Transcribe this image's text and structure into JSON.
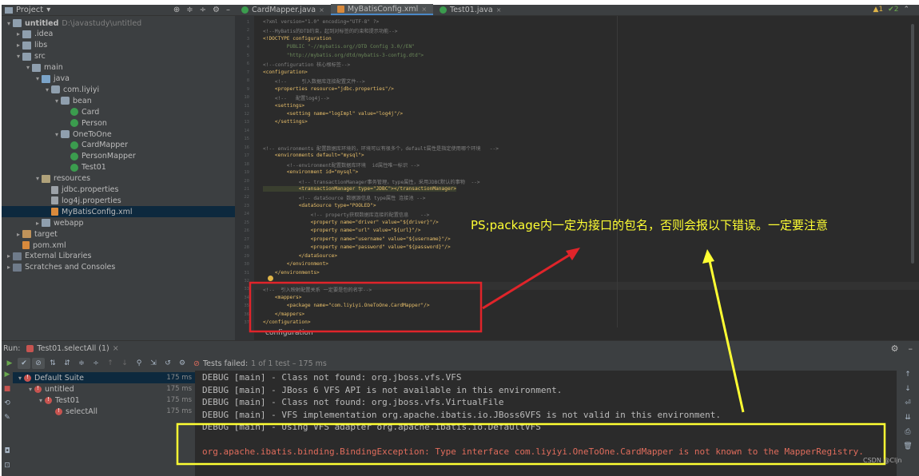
{
  "project": {
    "title": "Project",
    "tree": [
      {
        "label": "untitled",
        "path": "D:\\javastudy\\untitled",
        "arrow": "▾",
        "icon": "folder",
        "indent": 0,
        "bold": true
      },
      {
        "label": ".idea",
        "arrow": "▸",
        "icon": "folder",
        "indent": 1
      },
      {
        "label": "libs",
        "arrow": "▸",
        "icon": "folder",
        "indent": 1
      },
      {
        "label": "src",
        "arrow": "▾",
        "icon": "folder",
        "indent": 1
      },
      {
        "label": "main",
        "arrow": "▾",
        "icon": "folder",
        "indent": 2
      },
      {
        "label": "java",
        "arrow": "▾",
        "icon": "src",
        "indent": 3
      },
      {
        "label": "com.liyiyi",
        "arrow": "▾",
        "icon": "pkg",
        "indent": 4
      },
      {
        "label": "bean",
        "arrow": "▾",
        "icon": "pkg",
        "indent": 5
      },
      {
        "label": "Card",
        "arrow": "",
        "icon": "class",
        "indent": 6
      },
      {
        "label": "Person",
        "arrow": "",
        "icon": "class",
        "indent": 6
      },
      {
        "label": "OneToOne",
        "arrow": "▾",
        "icon": "pkg",
        "indent": 5
      },
      {
        "label": "CardMapper",
        "arrow": "",
        "icon": "class",
        "indent": 6
      },
      {
        "label": "PersonMapper",
        "arrow": "",
        "icon": "class",
        "indent": 6
      },
      {
        "label": "Test01",
        "arrow": "",
        "icon": "class",
        "indent": 6
      },
      {
        "label": "resources",
        "arrow": "▾",
        "icon": "res",
        "indent": 3
      },
      {
        "label": "jdbc.properties",
        "arrow": "",
        "icon": "file",
        "indent": 4
      },
      {
        "label": "log4j.properties",
        "arrow": "",
        "icon": "file",
        "indent": 4
      },
      {
        "label": "MyBatisConfig.xml",
        "arrow": "",
        "icon": "xml",
        "indent": 4,
        "selected": true
      },
      {
        "label": "webapp",
        "arrow": "▸",
        "icon": "folder",
        "indent": 3
      },
      {
        "label": "target",
        "arrow": "▸",
        "icon": "target",
        "indent": 1
      },
      {
        "label": "pom.xml",
        "arrow": "",
        "icon": "xml",
        "indent": 1
      },
      {
        "label": "External Libraries",
        "arrow": "▸",
        "icon": "lib",
        "indent": 0
      },
      {
        "label": "Scratches and Consoles",
        "arrow": "▸",
        "icon": "lib",
        "indent": 0
      }
    ]
  },
  "editor": {
    "tabs": [
      {
        "label": "CardMapper.java",
        "icon": "class",
        "active": false
      },
      {
        "label": "MyBatisConfig.xml",
        "icon": "xml",
        "active": true
      },
      {
        "label": "Test01.java",
        "icon": "class",
        "active": false
      }
    ],
    "inspections": {
      "warnings": "▲1",
      "ok": "✔2"
    },
    "breadcrumb": "configuration",
    "lines": [
      "<?xml version=\"1.0\" encoding=\"UTF-8\" ?>",
      "<!--MyBatis的DTD约束，起到对标签的约束和提示功能-->",
      "<!DOCTYPE configuration",
      "        PUBLIC \"-//mybatis.org//DTD Config 3.0//EN\"",
      "        \"http://mybatis.org/dtd/mybatis-3-config.dtd\">",
      "<!--configuration 核心根标签-->",
      "<configuration>",
      "    <!--     引入数据库连接配置文件-->",
      "    <properties resource=\"jdbc.properties\"/>",
      "    <!--   配置log4j-->",
      "    <settings>",
      "        <setting name=\"logImpl\" value=\"log4j\"/>",
      "    </settings>",
      "",
      "",
      "<!-- environments 配置数据库环境的，环境可以有很多个，default属性是指定使用哪个环境   -->",
      "    <environments default=\"mysql\">",
      "        <!--environment配置数据库环境  id属性唯一标识 -->",
      "        <environment id=\"mysql\">",
      "            <!-- transactionManager事务管理，type属性，采用JDBC默认的事物  -->",
      "            <transactionManager type=\"JDBC\"></transactionManager>",
      "            <!-- dataSource 数据源信息 type属性 连接池 -->",
      "            <dataSource type=\"POOLED\">",
      "                <!-- property获取数据库连接的配置信息    -->",
      "                <property name=\"driver\" value=\"${driver}\"/>",
      "                <property name=\"url\" value=\"${url}\"/>",
      "                <property name=\"username\" value=\"${username}\"/>",
      "                <property name=\"password\" value=\"${password}\"/>",
      "            </dataSource>",
      "        </environment>",
      "    </environments>",
      "",
      "<!--  引入映射配置关系 一定要是包的名字-->",
      "    <mappers>",
      "        <package name=\"com.liyiyi.OneToOne.CardMapper\"/>",
      "    </mappers>",
      "</configuration>"
    ]
  },
  "run": {
    "label": "Run:",
    "tab": "Test01.selectAll (1)",
    "status": {
      "failed": "Tests failed:",
      "detail": "1 of 1 test – 175 ms"
    },
    "tests": [
      {
        "label": "Default Suite",
        "time": "175 ms",
        "arrow": "▾",
        "indent": 0,
        "selected": true
      },
      {
        "label": "untitled",
        "time": "175 ms",
        "arrow": "▾",
        "indent": 1
      },
      {
        "label": "Test01",
        "time": "175 ms",
        "arrow": "▾",
        "indent": 2
      },
      {
        "label": "selectAll",
        "time": "175 ms",
        "arrow": "",
        "indent": 3
      }
    ],
    "console": [
      {
        "text": "DEBUG [main] - Class not found: org.jboss.vfs.VFS",
        "err": false
      },
      {
        "text": "DEBUG [main] - JBoss 6 VFS API is not available in this environment.",
        "err": false
      },
      {
        "text": "DEBUG [main] - Class not found: org.jboss.vfs.VirtualFile",
        "err": false
      },
      {
        "text": "DEBUG [main] - VFS implementation org.apache.ibatis.io.JBoss6VFS is not valid in this environment.",
        "err": false
      },
      {
        "text": "DEBUG [main] - Using VFS adapter org.apache.ibatis.io.DefaultVFS",
        "err": false
      },
      {
        "text": "",
        "err": false
      },
      {
        "text": "org.apache.ibatis.binding.BindingException: Type interface com.liyiyi.OneToOne.CardMapper is not known to the MapperRegistry.",
        "err": true
      }
    ]
  },
  "annotation": {
    "text": "PS;package内一定为接口的包名，否则会报以下错误。一定要注意",
    "colors": {
      "box": "#e0242a",
      "box2": "#ffff33",
      "arrow_red": "#e0242a",
      "arrow_yellow": "#ffff33"
    }
  },
  "watermark": "CSDN @Cljn"
}
